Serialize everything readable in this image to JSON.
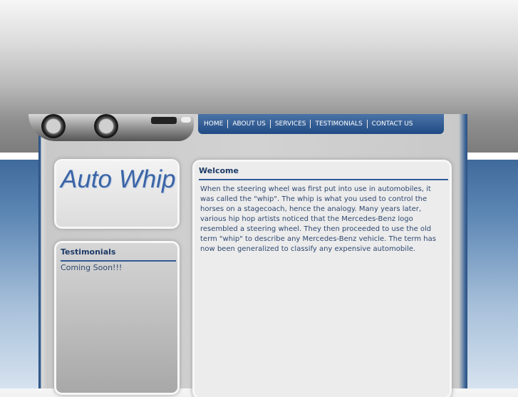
{
  "nav": {
    "items": [
      "HOME",
      "ABOUT US",
      "SERVICES",
      "TESTIMONIALS",
      "CONTACT US"
    ]
  },
  "logo": {
    "text": "Auto Whip"
  },
  "sidebar": {
    "testimonials": {
      "title": "Testimonials",
      "body": "Coming Soon!!!"
    }
  },
  "main": {
    "title": "Welcome",
    "body": "When the steering wheel was first put into use in automobiles, it was called the \"whip\". The whip is what you used to control the horses on a stagecoach, hence the analogy. Many years later, various hip hop artists noticed that the Mercedes-Benz logo resembled a steering wheel. They then proceeded to use the old term \"whip\" to describe any Mercedes-Benz vehicle. The term has now been generalized to classify any expensive automobile."
  },
  "colors": {
    "nav_bg": "#1f4a84",
    "heading_text": "#1d3a66",
    "body_text": "#2e4870",
    "logo_text": "#3a64a6"
  }
}
